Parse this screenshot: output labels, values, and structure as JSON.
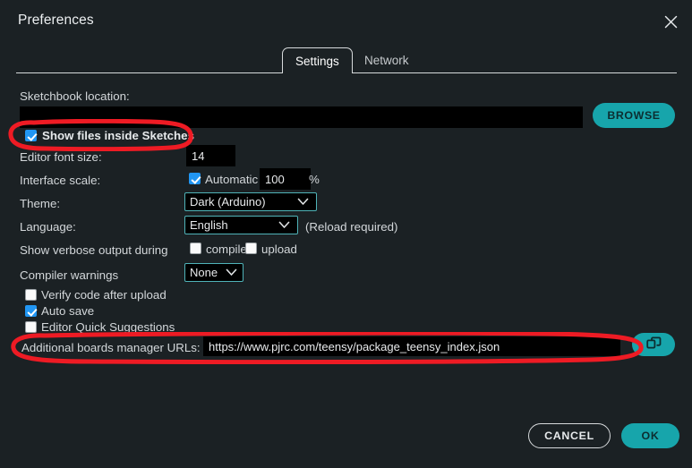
{
  "window": {
    "title": "Preferences",
    "close_icon": "close-icon"
  },
  "tabs": [
    {
      "label": "Settings",
      "active": true
    },
    {
      "label": "Network",
      "active": false
    }
  ],
  "settings": {
    "sketchbook": {
      "label": "Sketchbook location:",
      "value": "",
      "browse_label": "BROWSE"
    },
    "show_files": {
      "label": "Show files inside Sketches",
      "checked": true
    },
    "editor_font_size": {
      "label": "Editor font size:",
      "value": "14"
    },
    "interface_scale": {
      "label": "Interface scale:",
      "automatic_label": "Automatic",
      "automatic_checked": true,
      "value": "100",
      "unit": "%"
    },
    "theme": {
      "label": "Theme:",
      "value": "Dark (Arduino)",
      "options": [
        "Dark (Arduino)"
      ]
    },
    "language": {
      "label": "Language:",
      "value": "English",
      "options": [
        "English"
      ],
      "note": "(Reload required)"
    },
    "verbose": {
      "label": "Show verbose output during",
      "compile_label": "compile",
      "compile_checked": false,
      "upload_label": "upload",
      "upload_checked": false
    },
    "compiler_warnings": {
      "label": "Compiler warnings",
      "value": "None",
      "options": [
        "None"
      ]
    },
    "verify_code": {
      "label": "Verify code after upload",
      "checked": false
    },
    "auto_save": {
      "label": "Auto save",
      "checked": true
    },
    "quick_suggestions": {
      "label": "Editor Quick Suggestions",
      "checked": false
    },
    "additional_urls": {
      "label": "Additional boards manager URLs:",
      "value": "https://www.pjrc.com/teensy/package_teensy_index.json",
      "expand_icon": "open-windows-icon"
    }
  },
  "footer": {
    "cancel_label": "CANCEL",
    "ok_label": "OK"
  },
  "colors": {
    "background": "#1b2124",
    "accent_teal": "#17a5ab",
    "checkbox_blue": "#2196f3",
    "annotation_red": "#ee1b24",
    "field_black": "#000000",
    "text": "#dfe2e4",
    "select_border": "#4fb3b8"
  },
  "annotations": [
    {
      "name": "show-files-highlight",
      "shape": "ellipse"
    },
    {
      "name": "additional-urls-highlight",
      "shape": "ellipse"
    }
  ]
}
